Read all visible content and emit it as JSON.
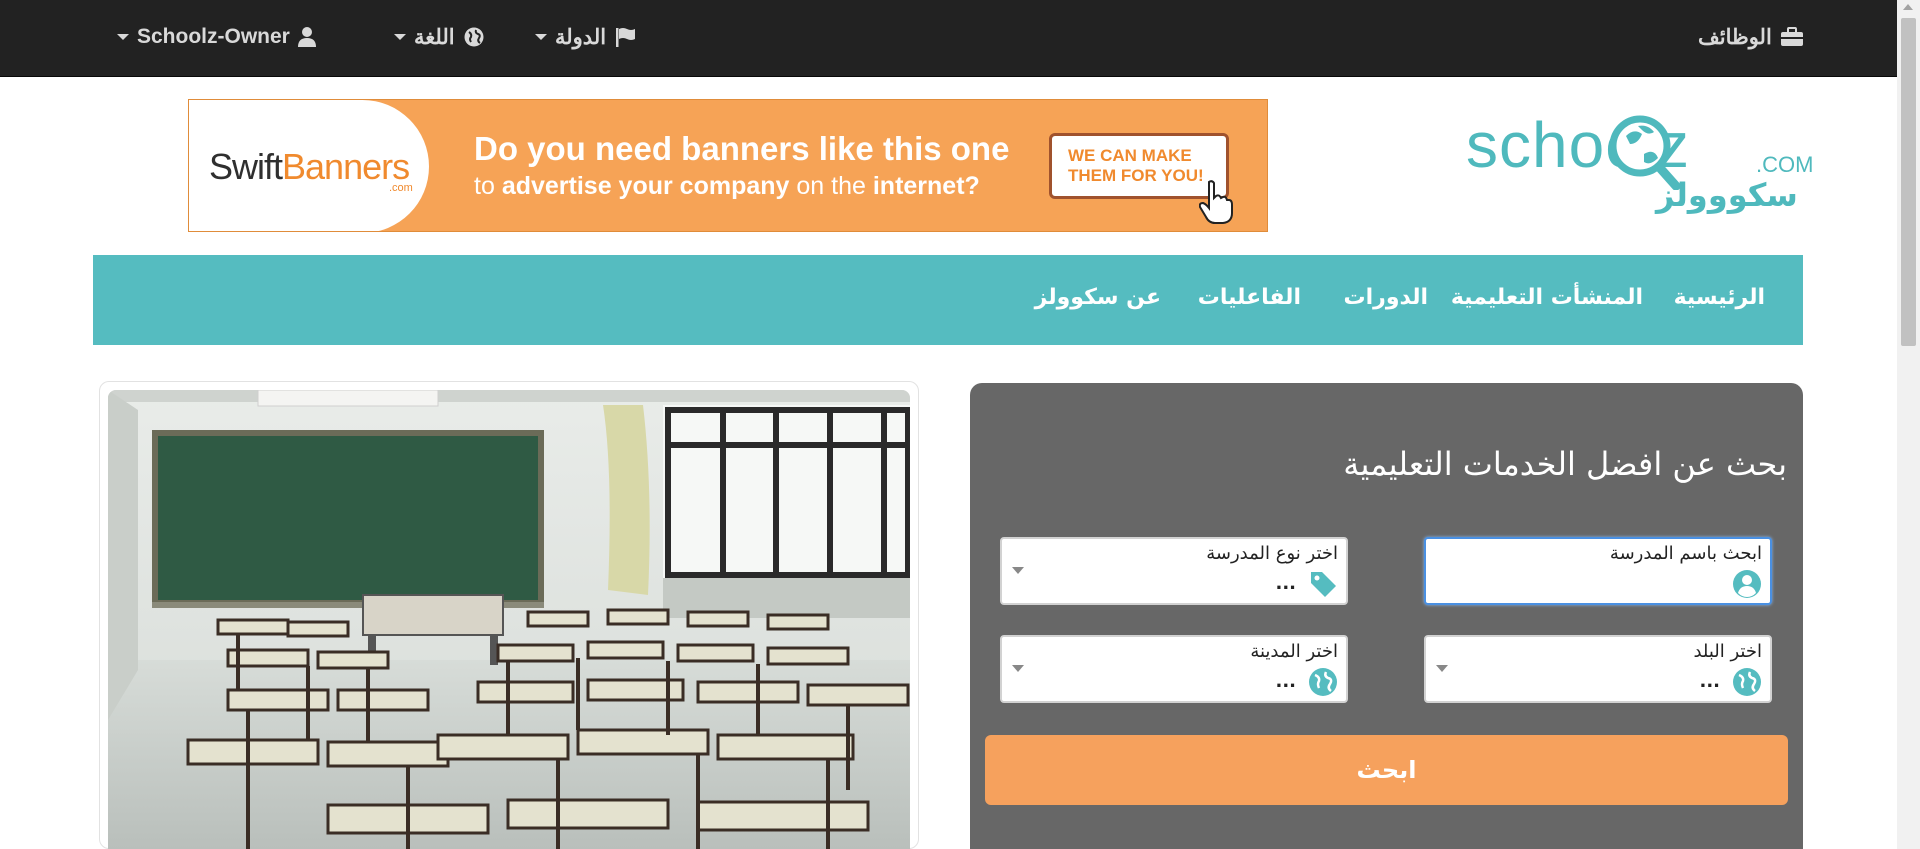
{
  "topbar": {
    "jobs_label": "الوظائف",
    "country_label": "الدولة",
    "language_label": "اللغة",
    "account_label": "Schoolz-Owner",
    "background": "#222222"
  },
  "banner": {
    "brand_part1": "Swift",
    "brand_part2": "Banners",
    "brand_sub": ".com",
    "headline": "Do you need banners like this one",
    "subline_1": "to",
    "subline_2": "advertise your company",
    "subline_3": "on the",
    "subline_4": "internet?",
    "cta_line1": "WE CAN MAKE",
    "cta_line2": "THEM FOR YOU!",
    "background": "#f6a356"
  },
  "logo": {
    "text": "schoolz",
    "com": ".COM",
    "arabic": "سكووولز"
  },
  "nav": {
    "items": [
      "الرئيسية",
      "المنشأت التعليمية",
      "الدورات",
      "الفاعليات",
      "عن سكوولز"
    ],
    "background": "#55bcc0"
  },
  "search": {
    "title": "بحث عن افضل الخدمات التعليمية",
    "school_name_label": "ابحث باسم المدرسة",
    "school_type_label": "اختر نوع المدرسة",
    "school_type_value": "...",
    "country_label": "اختر البلد",
    "country_value": "...",
    "city_label": "اختر المدينة",
    "city_value": "...",
    "button_label": "ابحث",
    "panel_color": "#676767",
    "button_color": "#f6a15d",
    "icon_color": "#55bcc0"
  }
}
